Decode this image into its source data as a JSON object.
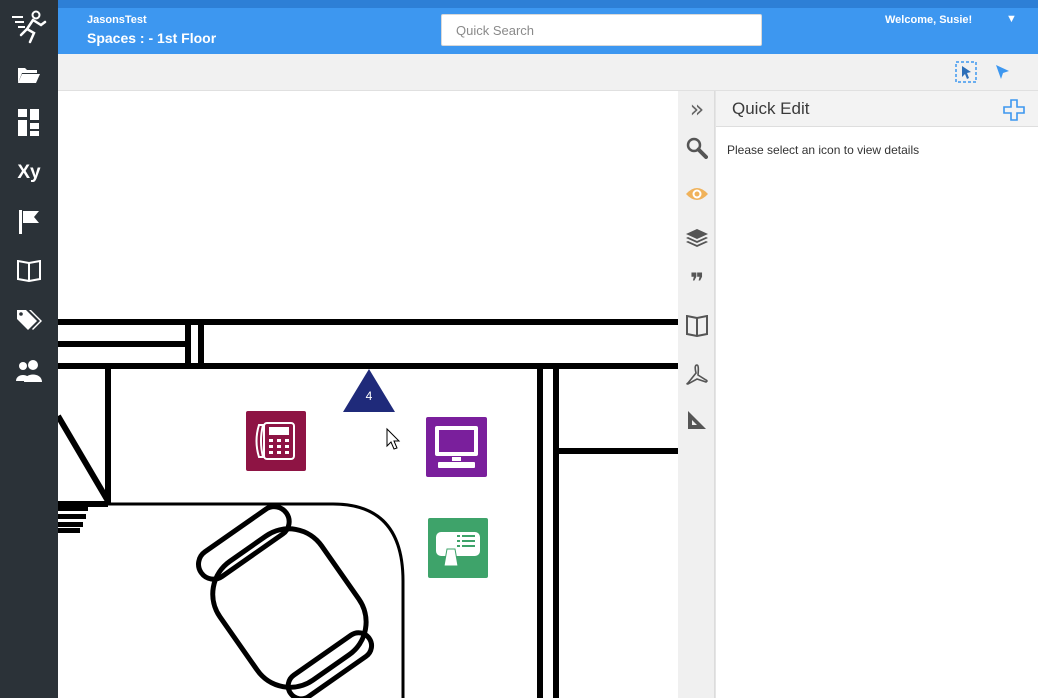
{
  "header": {
    "app_name": "JasonsTest",
    "page_title": "Spaces : - 1st Floor",
    "welcome": "Welcome, Susie!",
    "user_caret": "▼"
  },
  "search": {
    "placeholder": "Quick Search",
    "value": ""
  },
  "nav": {
    "items": [
      {
        "icon": "running-person-icon"
      },
      {
        "icon": "folder-open-icon"
      },
      {
        "icon": "dashboard-grid-icon"
      },
      {
        "icon": "xy-coordinates-icon",
        "label": "Xy"
      },
      {
        "icon": "flag-icon"
      },
      {
        "icon": "book-open-icon"
      },
      {
        "icon": "tags-icon"
      },
      {
        "icon": "users-icon"
      }
    ]
  },
  "toolbar": {
    "tools": [
      {
        "icon": "select-area-icon"
      },
      {
        "icon": "pointer-arrow-icon"
      }
    ]
  },
  "side_tools": {
    "items": [
      {
        "icon": "double-chevron-right-icon",
        "glyph": "»"
      },
      {
        "icon": "magnifier-icon"
      },
      {
        "icon": "eye-icon"
      },
      {
        "icon": "layers-icon"
      },
      {
        "icon": "quote-icon",
        "glyph": "❞"
      },
      {
        "icon": "map-icon"
      },
      {
        "icon": "pdf-icon"
      },
      {
        "icon": "ruler-triangle-icon"
      }
    ]
  },
  "floor_plan": {
    "marker_label": "4"
  },
  "quick_edit": {
    "title": "Quick Edit",
    "message": "Please select an icon to view details"
  },
  "colors": {
    "nav_bg": "#2b3238",
    "header_bg": "#3d97f0",
    "phone_icon": "#8e1444",
    "computer_icon": "#7a1f9c",
    "printer_icon": "#3ea36a",
    "marker": "#1f2a7a",
    "eye_active": "#f0b25a"
  }
}
